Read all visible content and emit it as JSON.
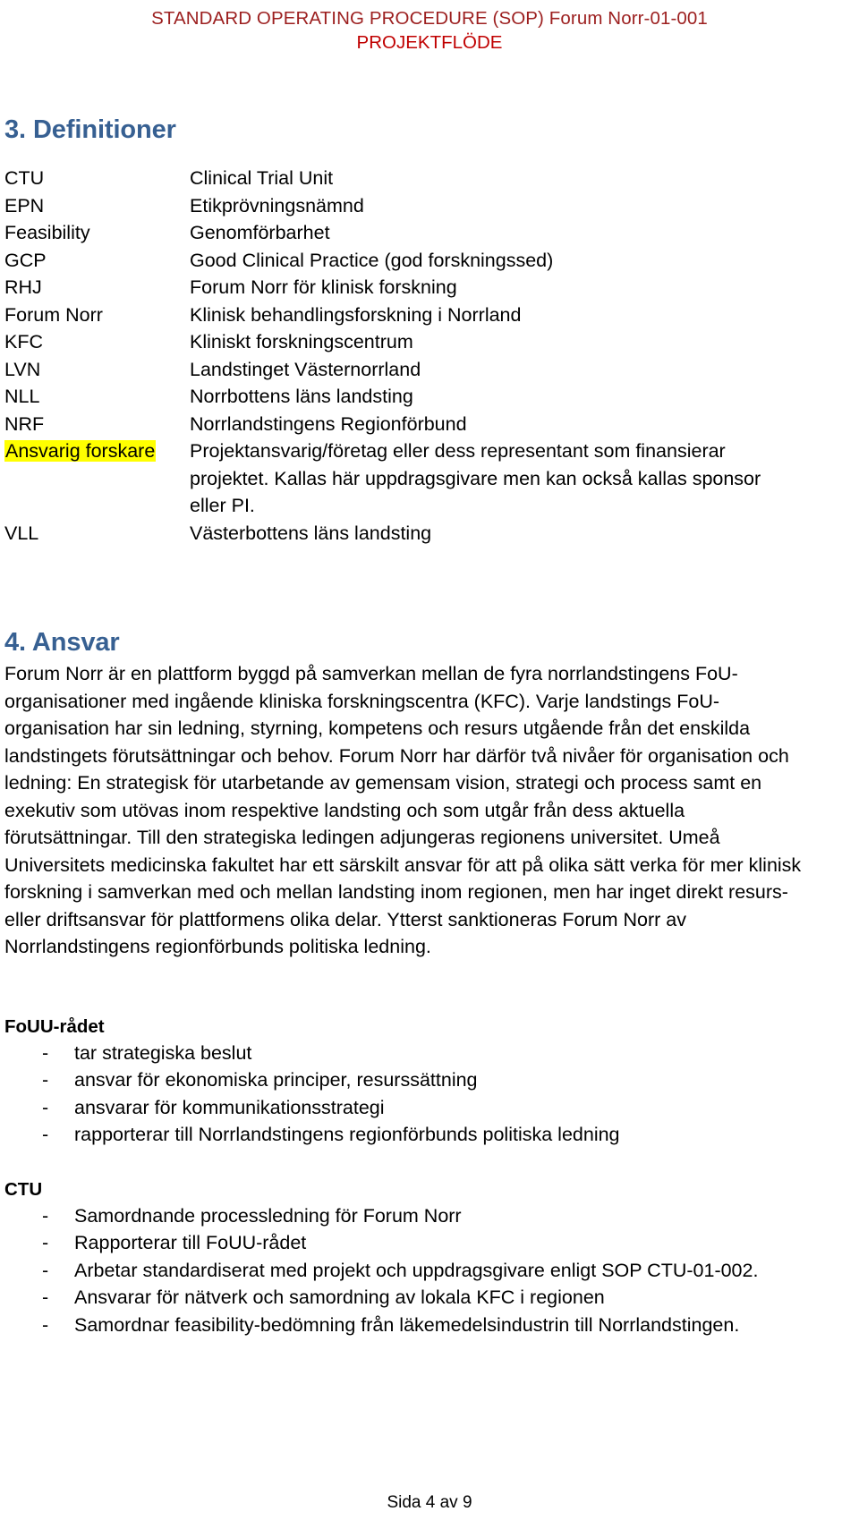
{
  "header": {
    "line1": "STANDARD OPERATING PROCEDURE (SOP) Forum Norr-01-001",
    "line2": "PROJEKTFLÖDE",
    "line1_color": "#9C1F1F",
    "line2_color": "#C00000"
  },
  "sections": {
    "definitions": {
      "heading": "3. Definitioner",
      "heading_color": "#376092",
      "rows": [
        {
          "term": "CTU",
          "desc": "Clinical Trial Unit",
          "highlight": false
        },
        {
          "term": "EPN",
          "desc": "Etikprövningsnämnd",
          "highlight": false
        },
        {
          "term": "Feasibility",
          "desc": "Genomförbarhet",
          "highlight": false
        },
        {
          "term": "GCP",
          "desc": "Good Clinical Practice (god forskningssed)",
          "highlight": false
        },
        {
          "term": "RHJ",
          "desc": "Forum Norr för klinisk forskning",
          "highlight": false
        },
        {
          "term": "Forum Norr",
          "desc": "Klinisk behandlingsforskning i Norrland",
          "highlight": false
        },
        {
          "term": "KFC",
          "desc": "Kliniskt forskningscentrum",
          "highlight": false
        },
        {
          "term": "LVN",
          "desc": "Landstinget Västernorrland",
          "highlight": false
        },
        {
          "term": "NLL",
          "desc": "Norrbottens läns landsting",
          "highlight": false
        },
        {
          "term": "NRF",
          "desc": "Norrlandstingens Regionförbund",
          "highlight": false
        },
        {
          "term": "Ansvarig forskare",
          "desc": "Projektansvarig/företag eller dess representant som finansierar",
          "highlight": true
        },
        {
          "term": "",
          "desc": "projektet. Kallas här uppdragsgivare men kan också kallas sponsor",
          "highlight": false
        },
        {
          "term": "",
          "desc": "eller PI.",
          "highlight": false
        },
        {
          "term": "VLL",
          "desc": "Västerbottens läns landsting",
          "highlight": false
        }
      ],
      "highlight_color": "#FFFF00"
    },
    "ansvar": {
      "heading": "4. Ansvar",
      "heading_color": "#376092",
      "paragraph": "Forum Norr är en plattform byggd på samverkan mellan de fyra norrlandstingens FoU-organisationer med ingående kliniska forskningscentra (KFC).  Varje landstings FoU-organisation har sin ledning, styrning, kompetens och resurs utgående från det enskilda landstingets förutsättningar och behov. Forum Norr har därför två nivåer för organisation och ledning: En strategisk för utarbetande av gemensam vision, strategi och process samt en exekutiv som utövas inom respektive landsting och som utgår från dess aktuella förutsättningar. Till den strategiska ledingen adjungeras regionens universitet. Umeå Universitets medicinska fakultet har ett särskilt ansvar för att på olika sätt verka för mer klinisk forskning i samverkan med och mellan landsting inom regionen, men har inget direkt resurs- eller driftsansvar för plattformens olika delar. Ytterst sanktioneras Forum Norr av Norrlandstingens regionförbunds politiska ledning."
    },
    "fouu_radet": {
      "title": "FoUU-rådet",
      "bullet_marker": "-",
      "items": [
        "tar strategiska beslut",
        "ansvar för ekonomiska principer, resurssättning",
        "ansvarar för kommunikationsstrategi",
        "rapporterar till Norrlandstingens regionförbunds politiska ledning"
      ]
    },
    "ctu": {
      "title": "CTU",
      "bullet_marker": "-",
      "items": [
        "Samordnande processledning för Forum Norr",
        "Rapporterar till FoUU-rådet",
        "Arbetar standardiserat med projekt och uppdragsgivare enligt SOP CTU-01-002.",
        "Ansvarar för nätverk och samordning av lokala KFC i regionen",
        "Samordnar feasibility-bedömning från läkemedelsindustrin till Norrlandstingen."
      ]
    }
  },
  "footer": {
    "page_label": "Sida 4 av 9"
  }
}
